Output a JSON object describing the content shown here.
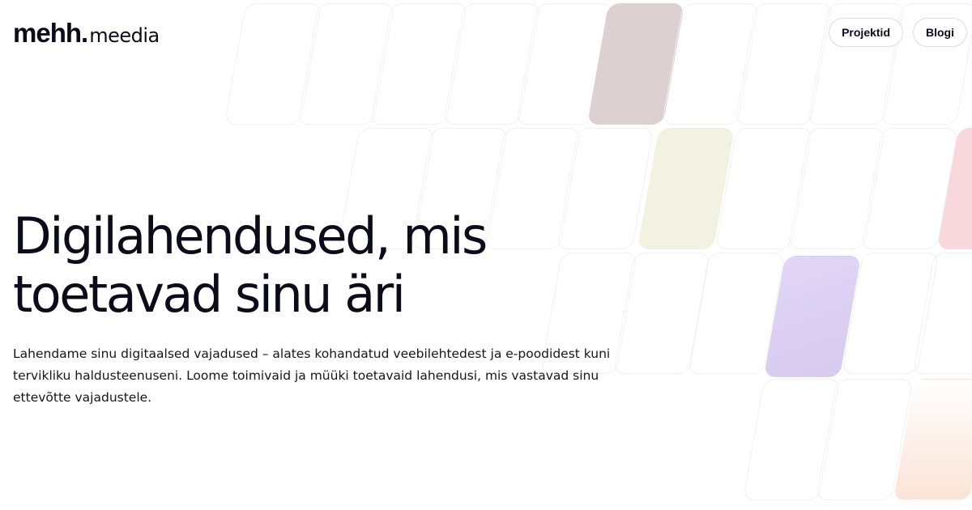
{
  "brand": {
    "name_strong": "mehh.",
    "name_light": "meedia"
  },
  "nav": {
    "items": [
      {
        "label": "Projektid"
      },
      {
        "label": "Blogi"
      }
    ]
  },
  "hero": {
    "title_line1": "Digilahendused, mis",
    "title_line2": "toetavad sinu äri",
    "lead": "Lahendame sinu digitaalsed vajadused – alates kohandatud veebilehtedest ja e-poodidest kuni tervikliku haldusteenuseni. Loome toimivaid ja müüki toetavaid lahendusi, mis vastavad sinu ettevõtte vajadustele."
  },
  "colors": {
    "text": "#0b0b1a",
    "tile_border": "#f1f1f4",
    "tile_mauve": "#dcd0d0",
    "tile_cream": "#f3f2e2",
    "tile_lavender": "#ddd2f3",
    "tile_pink": "#f8d8dc",
    "tile_peach": "#fbe3d6"
  }
}
